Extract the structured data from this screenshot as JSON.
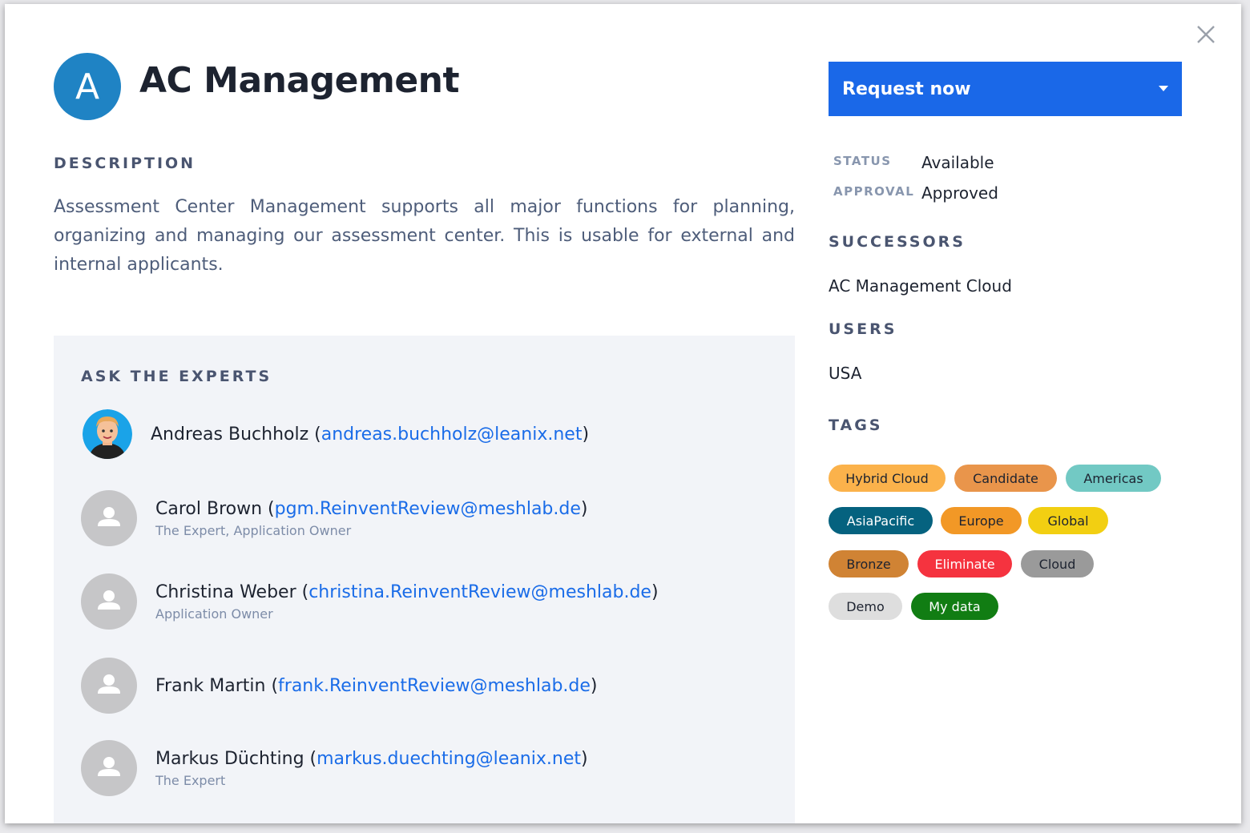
{
  "header": {
    "avatar_letter": "A",
    "title": "AC Management"
  },
  "description": {
    "heading": "DESCRIPTION",
    "text": "Assessment Center Management supports all major functions for planning, organizing and managing our assessment center. This is usable for external and internal applicants."
  },
  "experts": {
    "heading": "ASK THE EXPERTS",
    "items": [
      {
        "name": "Andreas Buchholz",
        "email": "andreas.buchholz@leanix.net",
        "role": ""
      },
      {
        "name": "Carol Brown",
        "email": "pgm.ReinventReview@meshlab.de",
        "role": "The Expert, Application Owner"
      },
      {
        "name": "Christina Weber",
        "email": "christina.ReinventReview@meshlab.de",
        "role": "Application Owner"
      },
      {
        "name": "Frank Martin",
        "email": "frank.ReinventReview@meshlab.de",
        "role": ""
      },
      {
        "name": "Markus Düchting",
        "email": "markus.duechting@leanix.net",
        "role": "The Expert"
      }
    ]
  },
  "request_button": {
    "label": "Request now"
  },
  "meta": {
    "status_label": "STATUS",
    "status_value": "Available",
    "approval_label": "APPROVAL",
    "approval_value": "Approved"
  },
  "successors": {
    "heading": "SUCCESSORS",
    "value": "AC Management Cloud"
  },
  "users": {
    "heading": "USERS",
    "value": "USA"
  },
  "tags": {
    "heading": "TAGS",
    "items": [
      {
        "label": "Hybrid Cloud",
        "color": "#fbb24b",
        "text_color": "#1d2330"
      },
      {
        "label": "Candidate",
        "color": "#e9954b",
        "text_color": "#1d2330"
      },
      {
        "label": "Americas",
        "color": "#72c9c4",
        "text_color": "#1d2330"
      },
      {
        "label": "AsiaPacific",
        "color": "#05627f",
        "text_color": "#ffffff"
      },
      {
        "label": "Europe",
        "color": "#f29826",
        "text_color": "#1d2330"
      },
      {
        "label": "Global",
        "color": "#f2cf12",
        "text_color": "#1d2330"
      },
      {
        "label": "Bronze",
        "color": "#d08334",
        "text_color": "#1d2330"
      },
      {
        "label": "Eliminate",
        "color": "#f5333f",
        "text_color": "#ffffff"
      },
      {
        "label": "Cloud",
        "color": "#9a9a9a",
        "text_color": "#1d2330"
      },
      {
        "label": "Demo",
        "color": "#dedede",
        "text_color": "#1d2330"
      },
      {
        "label": "My data",
        "color": "#117d13",
        "text_color": "#ffffff"
      }
    ]
  },
  "colors": {
    "accent": "#1a68e8",
    "avatar": "#1f83c4",
    "link": "#1a6ce8"
  }
}
